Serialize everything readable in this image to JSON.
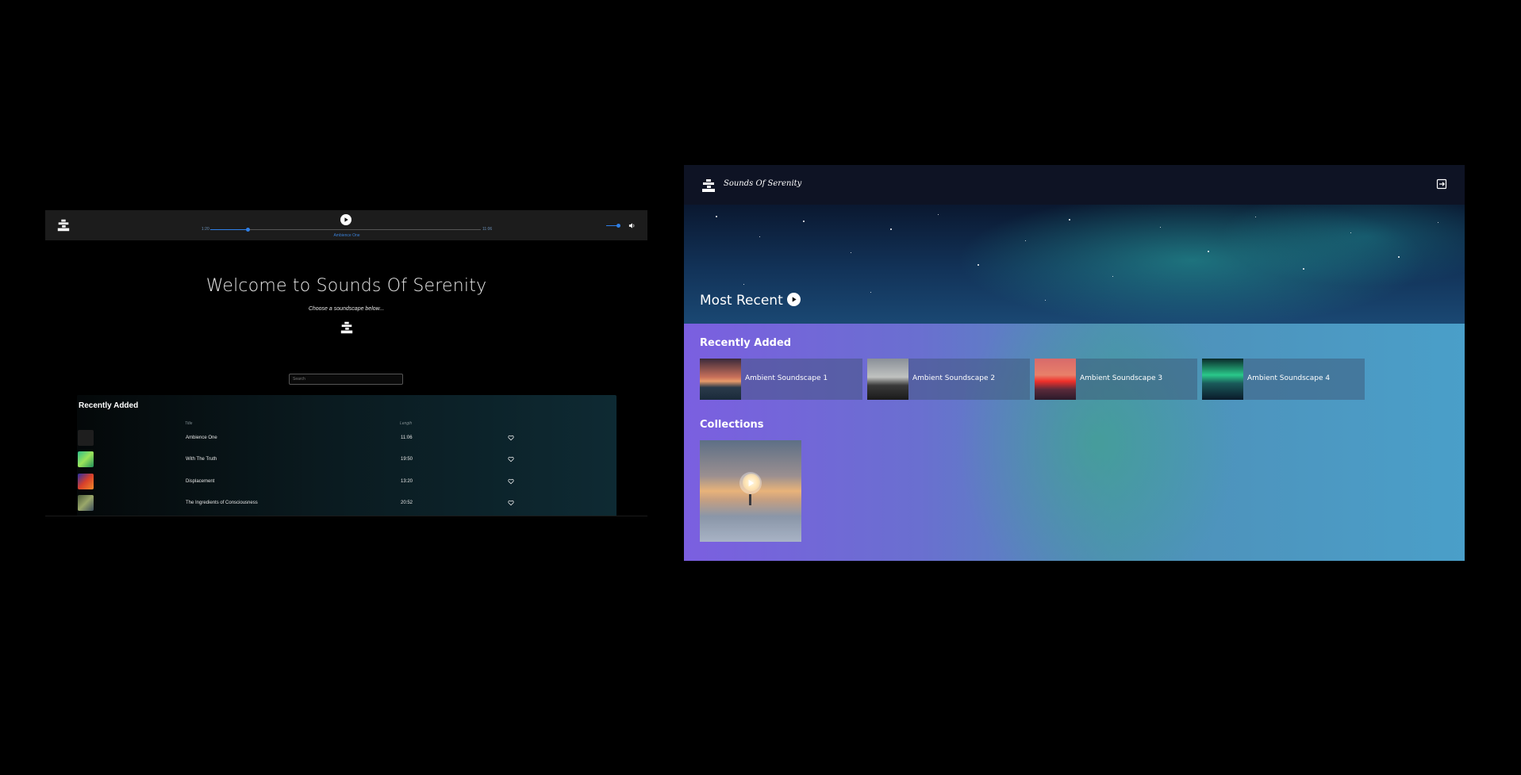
{
  "left_app": {
    "player": {
      "time_current": "1:20",
      "time_total": "11:06",
      "track_name": "Ambience One",
      "progress": 0.14,
      "volume": 0.75
    },
    "welcome": {
      "title": "Welcome to Sounds Of Serenity",
      "subtitle": "Choose a soundscape below..."
    },
    "search": {
      "placeholder": "Search"
    },
    "recently_added": {
      "title": "Recently Added",
      "columns": {
        "title": "Title",
        "length": "Length"
      },
      "rows": [
        {
          "title": "Ambience One",
          "length": "11:06",
          "thumb_color": "#1e1e1e"
        },
        {
          "title": "With The Truth",
          "length": "19:50",
          "thumb_color": "#3fbf6a"
        },
        {
          "title": "Displacement",
          "length": "13:20",
          "thumb_color": "#c23a2a"
        },
        {
          "title": "The Ingredients of Consciousness",
          "length": "20:52",
          "thumb_color": "#5a7a4a"
        }
      ]
    }
  },
  "right_app": {
    "brand": "Sounds Of Serenity",
    "hero_title": "Most Recent",
    "recently_added_title": "Recently Added",
    "cards": [
      {
        "label": "Ambient Soundscape 1"
      },
      {
        "label": "Ambient Soundscape 2"
      },
      {
        "label": "Ambient Soundscape 3"
      },
      {
        "label": "Ambient Soundscape 4"
      }
    ],
    "collections_title": "Collections"
  },
  "colors": {
    "accent_blue": "#2f7fe6",
    "purple": "#7b5fe0",
    "teal": "#4a9fc9"
  }
}
